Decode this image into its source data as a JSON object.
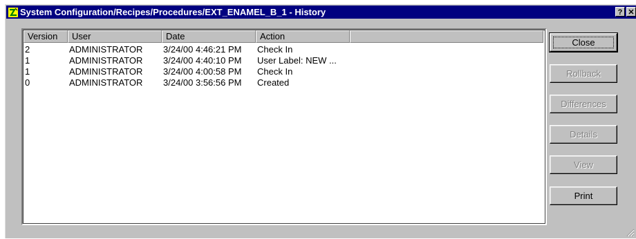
{
  "window": {
    "title": "System Configuration/Recipes/Procedures/EXT_ENAMEL_B_1 - History",
    "help_button": "?",
    "close_button": "✕"
  },
  "history": {
    "columns": [
      "Version",
      "User",
      "Date",
      "Action"
    ],
    "rows": [
      [
        "2",
        "ADMINISTRATOR",
        "3/24/00 4:46:21 PM",
        "Check In"
      ],
      [
        "1",
        "ADMINISTRATOR",
        "3/24/00 4:40:10 PM",
        "User Label: NEW ..."
      ],
      [
        "1",
        "ADMINISTRATOR",
        "3/24/00 4:00:58 PM",
        "Check In"
      ],
      [
        "0",
        "ADMINISTRATOR",
        "3/24/00 3:56:56 PM",
        "Created"
      ]
    ]
  },
  "buttons": {
    "close": "Close",
    "rollback": "Rollback",
    "differences": "Differences",
    "details": "Details",
    "view": "View",
    "print": "Print"
  },
  "colors": {
    "titlebar": "#000080",
    "face": "#c0c0c0",
    "disabled_text": "#808080"
  }
}
